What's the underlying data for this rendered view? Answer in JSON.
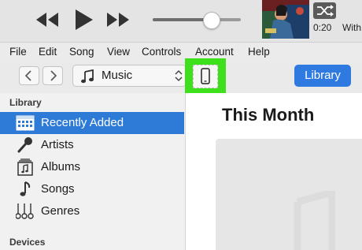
{
  "player": {
    "time": "0:20",
    "next_text": "With"
  },
  "menu": [
    "File",
    "Edit",
    "Song",
    "View",
    "Controls",
    "Account",
    "Help"
  ],
  "toolbar": {
    "source_label": "Music",
    "library_label": "Library"
  },
  "sidebar": {
    "library_heading": "Library",
    "items": [
      {
        "label": "Recently Added",
        "icon": "calendar-grid-icon"
      },
      {
        "label": "Artists",
        "icon": "microphone-icon"
      },
      {
        "label": "Albums",
        "icon": "album-icon"
      },
      {
        "label": "Songs",
        "icon": "music-note-icon"
      },
      {
        "label": "Genres",
        "icon": "guitars-icon"
      }
    ],
    "devices_heading": "Devices"
  },
  "main": {
    "title": "This Month"
  },
  "colors": {
    "accent": "#2d7ad7",
    "highlight": "#3ee01c"
  }
}
